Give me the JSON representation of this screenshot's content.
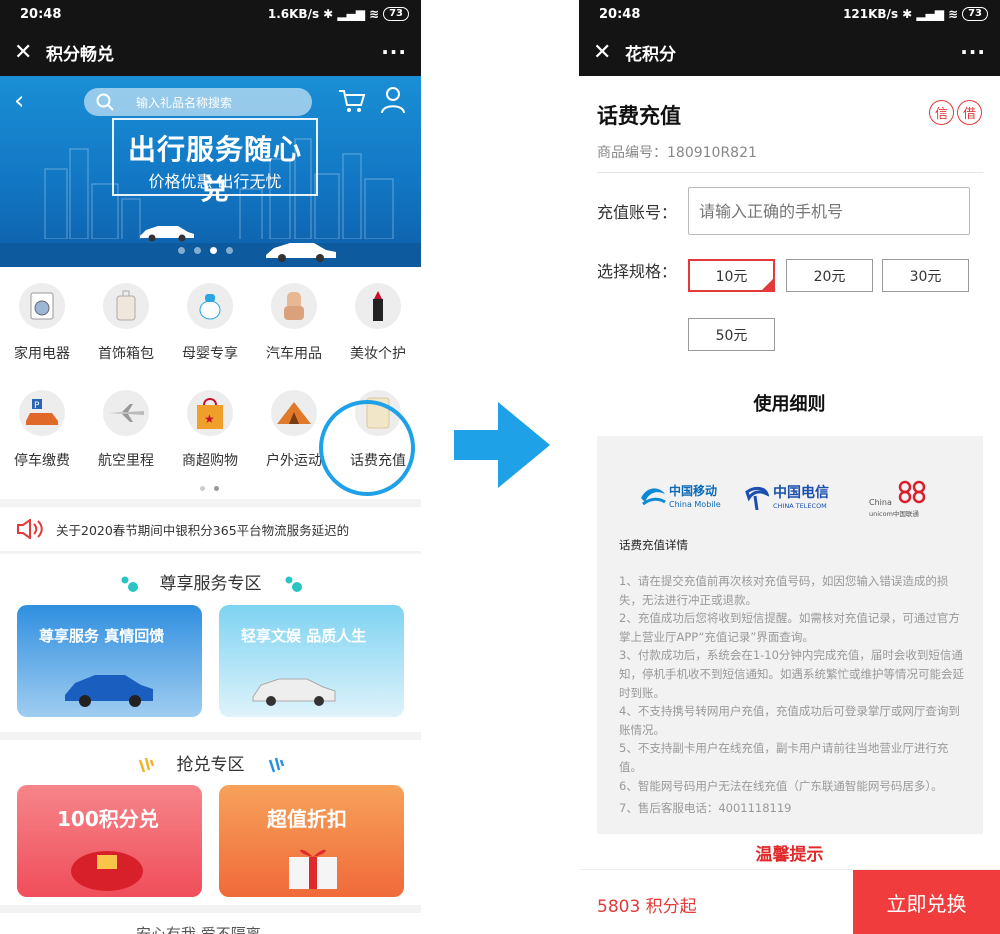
{
  "left": {
    "status": {
      "time": "20:48",
      "net": "1.6KB/s",
      "battery": "73"
    },
    "title": "积分畅兑",
    "more": "···",
    "banner": {
      "search_placeholder": "输入礼品名称搜索",
      "headline": "出行服务随心兑",
      "subline": "价格优惠 出行无忧"
    },
    "categories": [
      {
        "label": "家用电器",
        "icon": "washing-machine-icon"
      },
      {
        "label": "首饰箱包",
        "icon": "suitcase-icon"
      },
      {
        "label": "母婴专享",
        "icon": "baby-bottle-icon"
      },
      {
        "label": "汽车用品",
        "icon": "car-seat-icon"
      },
      {
        "label": "美妆个护",
        "icon": "lipstick-icon"
      },
      {
        "label": "停车缴费",
        "icon": "parking-car-icon"
      },
      {
        "label": "航空里程",
        "icon": "airplane-icon"
      },
      {
        "label": "商超购物",
        "icon": "shopping-bag-icon"
      },
      {
        "label": "户外运动",
        "icon": "tent-icon"
      },
      {
        "label": "话费充值",
        "icon": "phone-card-icon"
      }
    ],
    "notice": "关于2020春节期间中银积分365平台物流服务延迟的",
    "section1": "尊享服务专区",
    "cards1": [
      "尊享服务 真情回馈",
      "轻享文娱 品质人生"
    ],
    "section2": "抢兑专区",
    "cards2": [
      "100积分兑",
      "超值折扣"
    ],
    "section3_partial": "安心有我 爱不隔离"
  },
  "right": {
    "status": {
      "time": "20:48",
      "net": "121KB/s",
      "battery": "73"
    },
    "title": "花积分",
    "more": "···",
    "product_title": "话费充值",
    "badges": [
      "信",
      "借"
    ],
    "product_no": "商品编号：180910R821",
    "account_label": "充值账号：",
    "account_placeholder": "请输入正确的手机号",
    "spec_label": "选择规格：",
    "specs": [
      "10元",
      "20元",
      "30元",
      "50元"
    ],
    "selected_spec": "10元",
    "usage_title": "使用细则",
    "carriers": {
      "mobile_cn": "中国移动",
      "mobile_en": "China Mobile",
      "telecom_cn": "中国电信",
      "telecom_en": "CHINA TELECOM",
      "unicom_en1": "China",
      "unicom_en2": "unicom中国联通"
    },
    "detail_title": "话费充值详情",
    "details": [
      "1、请在提交充值前再次核对充值号码，如因您输入错误造成的损失，无法进行冲正或退款。",
      "2、充值成功后您将收到短信提醒。如需核对充值记录，可通过官方掌上营业厅APP“充值记录”界面查询。",
      "3、付款成功后，系统会在1-10分钟内完成充值，届时会收到短信通知，停机手机收不到短信通知。如遇系统繁忙或维护等情况可能会延时到账。",
      "4、不支持携号转网用户充值，充值成功后可登录掌厅或网厅查询到账情况。",
      "5、不支持副卡用户在线充值，副卡用户请前往当地营业厅进行充值。",
      "6、智能网号码用户无法在线充值（广东联通智能网号码居多）。",
      "7、售后客服电话：4001118119"
    ],
    "tip": "温馨提示",
    "points": "5803 积分起",
    "redeem": "立即兑换"
  }
}
